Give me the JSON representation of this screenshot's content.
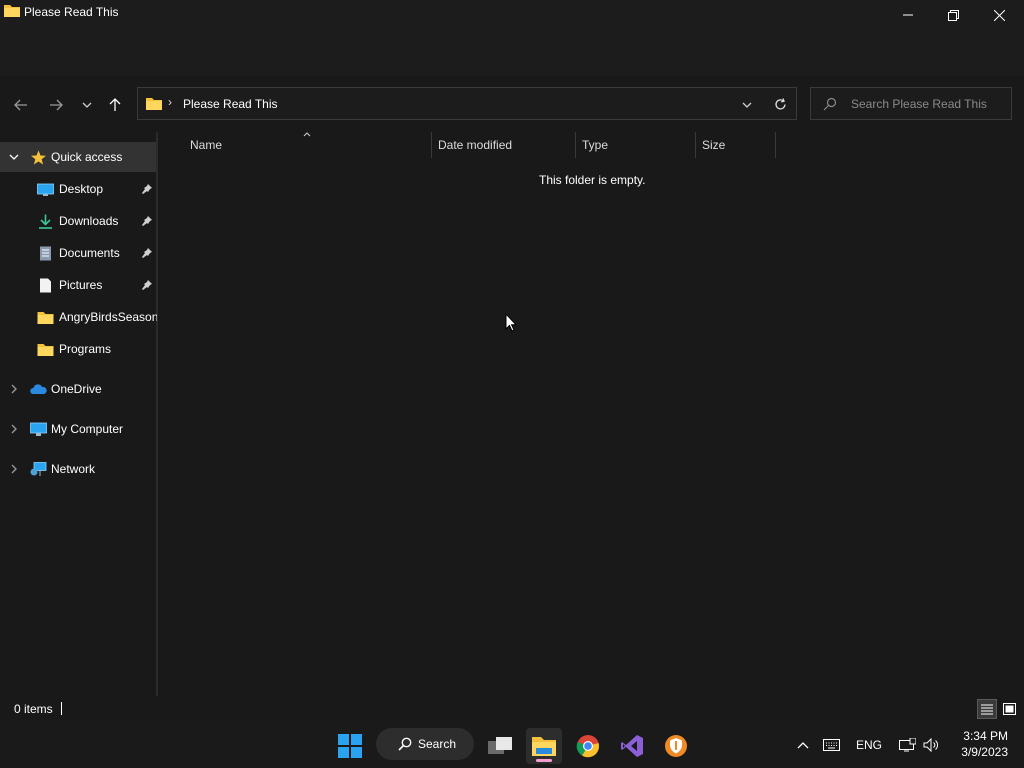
{
  "window": {
    "title": "Please Read This"
  },
  "address_bar": {
    "path_segment": "Please Read This",
    "chevron": "›"
  },
  "search": {
    "placeholder": "Search Please Read This"
  },
  "sidebar": {
    "quick_access": "Quick access",
    "items": [
      {
        "label": "Desktop",
        "icon": "desktop-icon",
        "pinned": true
      },
      {
        "label": "Downloads",
        "icon": "download-icon",
        "pinned": true
      },
      {
        "label": "Documents",
        "icon": "documents-icon",
        "pinned": true
      },
      {
        "label": "Pictures",
        "icon": "pictures-icon",
        "pinned": true
      },
      {
        "label": "AngryBirdsSeasons",
        "icon": "folder-icon",
        "pinned": false
      },
      {
        "label": "Programs",
        "icon": "folder-icon",
        "pinned": false
      }
    ],
    "roots": [
      {
        "label": "OneDrive",
        "icon": "onedrive-icon"
      },
      {
        "label": "My Computer",
        "icon": "computer-icon"
      },
      {
        "label": "Network",
        "icon": "network-icon"
      }
    ]
  },
  "columns": {
    "name": "Name",
    "date_modified": "Date modified",
    "type": "Type",
    "size": "Size"
  },
  "content": {
    "empty_message": "This folder is empty."
  },
  "statusbar": {
    "item_count": "0 items"
  },
  "taskbar": {
    "search_label": "Search",
    "language": "ENG",
    "time": "3:34 PM",
    "date": "3/9/2023",
    "apps": [
      "start-icon",
      "task-view-icon",
      "file-explorer-icon",
      "chrome-icon",
      "visual-studio-icon",
      "shield-app-icon"
    ]
  },
  "colors": {
    "background": "#191919",
    "folder_yellow": "#f3c13a",
    "selected_row": "#333333",
    "windows_blue": "#2aa3f0"
  }
}
